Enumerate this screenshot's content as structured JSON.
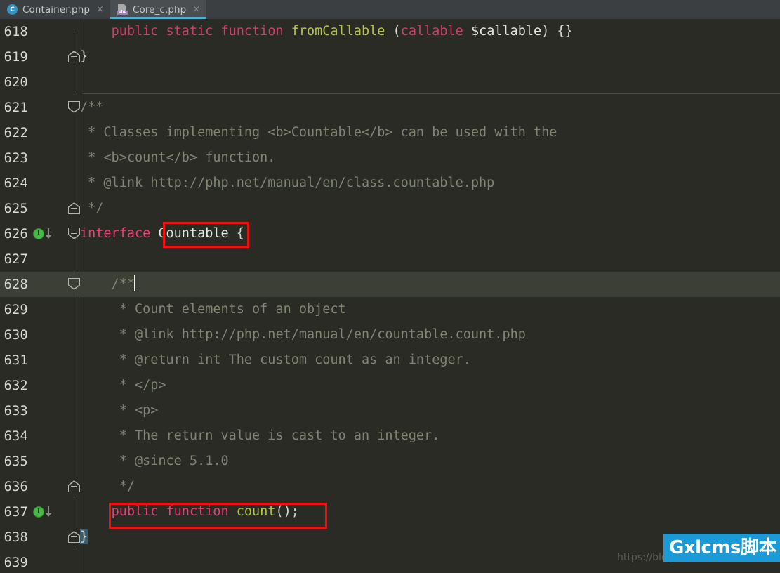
{
  "tabs": [
    {
      "label": "Container.php",
      "icon": "php-class-icon",
      "active": false,
      "close": "×"
    },
    {
      "label": "Core_c.php",
      "icon": "php-file-icon",
      "active": true,
      "close": "×"
    }
  ],
  "editor": {
    "first_line": 618,
    "current_line": 628,
    "lines": [
      {
        "num": "618",
        "indent": 0,
        "text": "public static function fromCallable (callable $callable) {}"
      },
      {
        "num": "619",
        "indent": 0,
        "text": "}"
      },
      {
        "num": "620",
        "indent": 0,
        "text": ""
      },
      {
        "num": "621",
        "indent": 0,
        "text": "/**"
      },
      {
        "num": "622",
        "indent": 0,
        "text": " * Classes implementing <b>Countable</b> can be used with the"
      },
      {
        "num": "623",
        "indent": 0,
        "text": " * <b>count</b> function."
      },
      {
        "num": "624",
        "indent": 0,
        "text": " * @link http://php.net/manual/en/class.countable.php"
      },
      {
        "num": "625",
        "indent": 0,
        "text": " */"
      },
      {
        "num": "626",
        "indent": 0,
        "text": "interface Countable {"
      },
      {
        "num": "627",
        "indent": 0,
        "text": ""
      },
      {
        "num": "628",
        "indent": 1,
        "text": "/**"
      },
      {
        "num": "629",
        "indent": 1,
        "text": " * Count elements of an object"
      },
      {
        "num": "630",
        "indent": 1,
        "text": " * @link http://php.net/manual/en/countable.count.php"
      },
      {
        "num": "631",
        "indent": 1,
        "text": " * @return int The custom count as an integer."
      },
      {
        "num": "632",
        "indent": 1,
        "text": " * </p>"
      },
      {
        "num": "633",
        "indent": 1,
        "text": " * <p>"
      },
      {
        "num": "634",
        "indent": 1,
        "text": " * The return value is cast to an integer."
      },
      {
        "num": "635",
        "indent": 1,
        "text": " * @since 5.1.0"
      },
      {
        "num": "636",
        "indent": 1,
        "text": " */"
      },
      {
        "num": "637",
        "indent": 1,
        "text": "public function count();"
      },
      {
        "num": "638",
        "indent": 0,
        "text": "}"
      },
      {
        "num": "639",
        "indent": 0,
        "text": ""
      }
    ],
    "gutter_markers": [
      {
        "line": "626",
        "type": "implemented-marker",
        "glyph": "I"
      },
      {
        "line": "637",
        "type": "implemented-marker",
        "glyph": "I"
      }
    ],
    "code_tokens": {
      "l618": [
        {
          "t": "    ",
          "c": "punct"
        },
        {
          "t": "public",
          "c": "kw"
        },
        {
          "t": " ",
          "c": "punct"
        },
        {
          "t": "static",
          "c": "kw"
        },
        {
          "t": " ",
          "c": "punct"
        },
        {
          "t": "function",
          "c": "kw"
        },
        {
          "t": " ",
          "c": "punct"
        },
        {
          "t": "fromCallable",
          "c": "fn"
        },
        {
          "t": " ",
          "c": "punct"
        },
        {
          "t": "(",
          "c": "punct"
        },
        {
          "t": "callable",
          "c": "kw"
        },
        {
          "t": " ",
          "c": "punct"
        },
        {
          "t": "$callable",
          "c": "var"
        },
        {
          "t": ") {}",
          "c": "punct"
        }
      ],
      "l619": [
        {
          "t": "}",
          "c": "punct"
        }
      ],
      "l621": [
        {
          "t": "/**",
          "c": "cmt"
        }
      ],
      "l622": [
        {
          "t": " * Classes implementing <b>Countable</b> can be used with the",
          "c": "cmt"
        }
      ],
      "l623": [
        {
          "t": " * <b>count</b> function.",
          "c": "cmt"
        }
      ],
      "l624": [
        {
          "t": " * @link http://php.net/manual/en/class.countable.php",
          "c": "cmt"
        }
      ],
      "l625": [
        {
          "t": " */",
          "c": "cmt"
        }
      ],
      "l626": [
        {
          "t": "interface",
          "c": "kw2"
        },
        {
          "t": " ",
          "c": "punct"
        },
        {
          "t": "Countable",
          "c": "var"
        },
        {
          "t": " {",
          "c": "punct"
        }
      ],
      "l628": [
        {
          "t": "    /**",
          "c": "cmt"
        }
      ],
      "l629": [
        {
          "t": "     * Count elements of an object",
          "c": "cmt"
        }
      ],
      "l630": [
        {
          "t": "     * @link http://php.net/manual/en/countable.count.php",
          "c": "cmt"
        }
      ],
      "l631": [
        {
          "t": "     * @return int The custom count as an integer.",
          "c": "cmt"
        }
      ],
      "l632": [
        {
          "t": "     * </p>",
          "c": "cmt"
        }
      ],
      "l633": [
        {
          "t": "     * <p>",
          "c": "cmt"
        }
      ],
      "l634": [
        {
          "t": "     * The return value is cast to an integer.",
          "c": "cmt"
        }
      ],
      "l635": [
        {
          "t": "     * @since 5.1.0",
          "c": "cmt"
        }
      ],
      "l636": [
        {
          "t": "     */",
          "c": "cmt"
        }
      ],
      "l637": [
        {
          "t": "    ",
          "c": "punct"
        },
        {
          "t": "public",
          "c": "kw2"
        },
        {
          "t": " ",
          "c": "punct"
        },
        {
          "t": "function",
          "c": "kw2"
        },
        {
          "t": " ",
          "c": "punct"
        },
        {
          "t": "count",
          "c": "fn"
        },
        {
          "t": "();",
          "c": "punct"
        }
      ],
      "l638": [
        {
          "t": "}",
          "c": "brace-hi"
        }
      ]
    }
  },
  "annotations": [
    {
      "name": "countable-highlight",
      "target": "Countable",
      "color": "#ee1111"
    },
    {
      "name": "count-method-highlight",
      "target": "public function count();",
      "color": "#ee1111"
    }
  ],
  "watermark": {
    "url": "https://blog.",
    "badge": "Gxlcms脚本",
    "badge_color": "#1a9ad6"
  },
  "theme": {
    "background": "#2b2b26",
    "current_line": "#3c3f35",
    "tabbar": "#3c3f41",
    "active_tab": "#4b4e50",
    "active_tab_underline": "#4eaecf",
    "keyword": "#cc3f6a",
    "function": "#b5c34a",
    "comment": "#7f8573",
    "line_number": "#d7d8d3"
  }
}
